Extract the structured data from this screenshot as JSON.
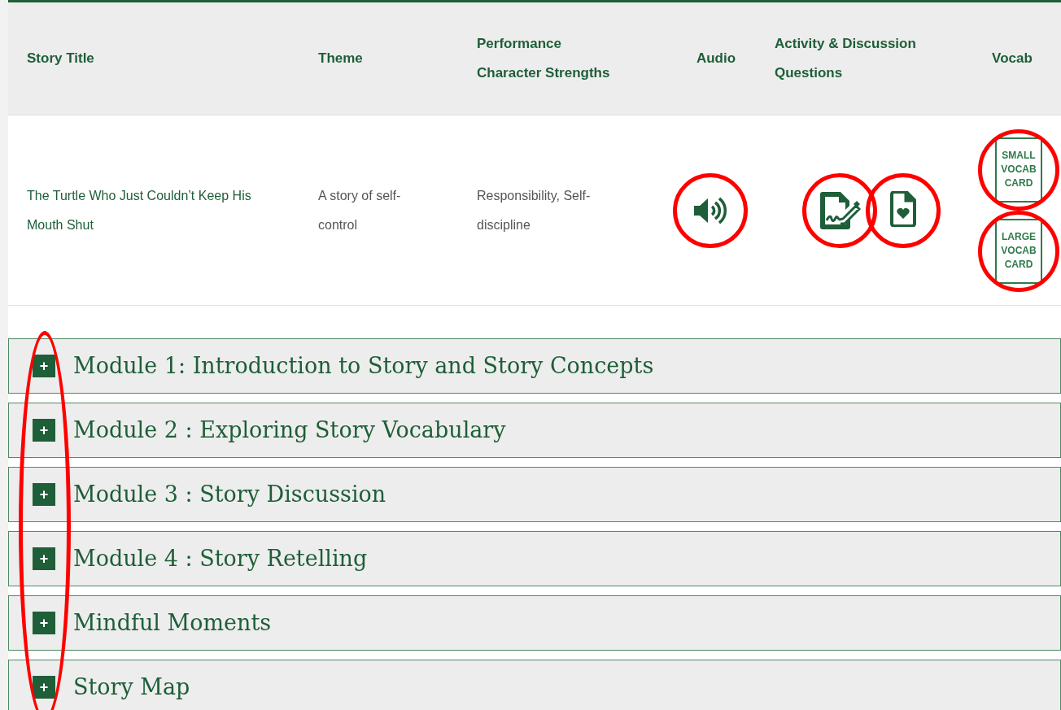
{
  "table": {
    "columns": [
      {
        "label": "Story Title"
      },
      {
        "label": "Theme"
      },
      {
        "label": "Performance Character Strengths"
      },
      {
        "label": "Audio"
      },
      {
        "label": "Activity & Discussion Questions"
      },
      {
        "label": "Vocab"
      }
    ],
    "rows": [
      {
        "story_title": "The Turtle Who Just Couldn’t Keep His Mouth Shut",
        "theme": "A story of self-control",
        "strengths": "Responsibility, Self-discipline",
        "audio": {
          "circled": true
        },
        "activities": [
          {
            "kind": "worksheet",
            "circled": true
          },
          {
            "kind": "heart-file",
            "circled": true
          }
        ],
        "vocab": [
          {
            "label": "SMALL VOCAB CARD",
            "circled": true
          },
          {
            "label": "LARGE VOCAB CARD",
            "circled": true
          }
        ]
      }
    ]
  },
  "modules": {
    "toggles_circled": true,
    "items": [
      {
        "title": "Module 1: Introduction to Story and Story Concepts",
        "toggle": "+"
      },
      {
        "title": "Module 2 : Exploring Story Vocabulary",
        "toggle": "+"
      },
      {
        "title": "Module 3 : Story Discussion",
        "toggle": "+"
      },
      {
        "title": "Module 4 : Story Retelling",
        "toggle": "+"
      },
      {
        "title": "Mindful Moments",
        "toggle": "+"
      },
      {
        "title": "Story Map",
        "toggle": "+"
      }
    ]
  }
}
